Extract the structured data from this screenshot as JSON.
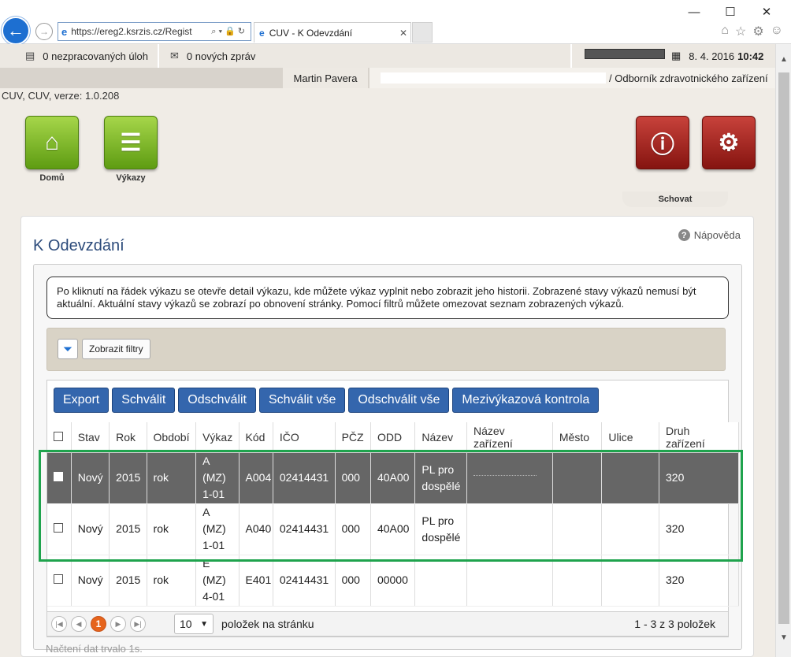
{
  "browser": {
    "url": "https://ereg2.ksrzis.cz/Regist",
    "tab_title": "CUV - K Odevzdání",
    "window_controls": [
      "—",
      "☐",
      "✕"
    ]
  },
  "topbar": {
    "tasks": "0 nezpracovaných úloh",
    "messages": "0 nových zpráv",
    "date": "8. 4. 2016",
    "time": "10:42",
    "user": "Martin Pavera",
    "role": "/ Odborník zdravotnického zařízení",
    "app_version": "CUV, CUV, verze: 1.0.208"
  },
  "tiles": {
    "home": "Domů",
    "reports": "Výkazy",
    "hide": "Schovat"
  },
  "page": {
    "title": "K Odevzdání",
    "help": "Nápověda",
    "note": "Po kliknutí na řádek výkazu se otevře detail výkazu, kde můžete výkaz vyplnit nebo zobrazit jeho historii. Zobrazené stavy výkazů nemusí být aktuální. Aktuální stavy výkazů se zobrazí po obnovení stránky. Pomocí filtrů můžete omezovat seznam zobrazených výkazů.",
    "show_filters": "Zobrazit filtry"
  },
  "actions": [
    "Export",
    "Schválit",
    "Odschválit",
    "Schválit vše",
    "Odschválit vše",
    "Mezivýkazová kontrola"
  ],
  "table": {
    "columns": [
      "Stav",
      "Rok",
      "Období",
      "Výkaz",
      "Kód",
      "IČO",
      "PČZ",
      "ODD",
      "Název",
      "Název zařízení",
      "Město",
      "Ulice",
      "Druh zařízení"
    ],
    "rows": [
      {
        "stav": "Nový",
        "rok": "2015",
        "obdobi": "rok",
        "vykaz": "A (MZ) 1-01",
        "kod": "A004",
        "ico": "02414431",
        "pcz": "000",
        "odd": "40A00",
        "nazev": "PL pro dospělé",
        "druh": "320"
      },
      {
        "stav": "Nový",
        "rok": "2015",
        "obdobi": "rok",
        "vykaz": "A (MZ) 1-01",
        "kod": "A040",
        "ico": "02414431",
        "pcz": "000",
        "odd": "40A00",
        "nazev": "PL pro dospělé",
        "druh": "320"
      },
      {
        "stav": "Nový",
        "rok": "2015",
        "obdobi": "rok",
        "vykaz": "E (MZ) 4-01",
        "kod": "E401",
        "ico": "02414431",
        "pcz": "000",
        "odd": "00000",
        "nazev": "",
        "druh": "320"
      }
    ]
  },
  "pager": {
    "current_page": "1",
    "page_size": "10",
    "page_size_label": "položek na stránku",
    "summary": "1 - 3 z 3 položek"
  },
  "load_time": "Načtení dat trvalo 1s."
}
